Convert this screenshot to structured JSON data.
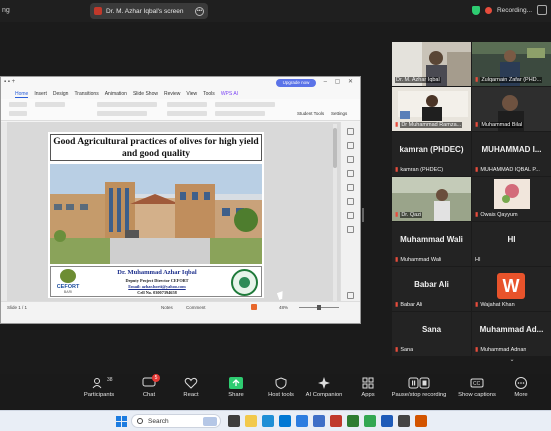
{
  "topbar": {
    "left_text": "ng",
    "share_indicator": "Dr. M. Azhar Iqbal's screen",
    "recording_label": "Recording..."
  },
  "document": {
    "upgrade_label": "Upgrade now",
    "ribbon_tabs": [
      "Home",
      "Insert",
      "Design",
      "Transitions",
      "Animation",
      "Slide Show",
      "Review",
      "View",
      "Tools",
      "WPS AI"
    ],
    "ribbon_labels": {
      "slide_tools": "Student Tools",
      "settings": "Settings"
    },
    "slide": {
      "title": "Good Agricultural practices of olives for high yield and good quality",
      "presenter": "Dr. Muhammad Azhar Iqbal",
      "designation": "Deputy Project Director CEFORT",
      "email": "Email: azhar.horti@yahoo.com",
      "cell": "Cell No. 03007394658",
      "logo_text": "CEFORT",
      "logo_sub": "BARI"
    },
    "statusbar": {
      "slide_num": "Slide 1 / 1",
      "notes": "Notes",
      "comment": "Comment",
      "zoom": "48%"
    }
  },
  "participants": [
    {
      "name": "Dr. M. Azhar Iqbal",
      "type": "video",
      "active": true,
      "muted": false
    },
    {
      "name": "Zulqarnain Zafar (PHD...",
      "type": "video",
      "muted": true
    },
    {
      "name": "Dr Muhammad Ramza...",
      "type": "video",
      "muted": true
    },
    {
      "name": "Muhammad Bilal",
      "type": "video",
      "muted": true
    },
    {
      "name": "kamran (PHDEC)",
      "big": "kamran  (PHDEC)",
      "type": "name",
      "muted": true
    },
    {
      "name": "MUHAMMAD IQBAL P...",
      "big": "MUHAMMAD  I...",
      "type": "name",
      "muted": true
    },
    {
      "name": "Dr. Qazi",
      "type": "video",
      "muted": true
    },
    {
      "name": "Owais Qayyum",
      "type": "video",
      "muted": true
    },
    {
      "name": "Muhammad Wali",
      "big": "Muhammad  Wali",
      "type": "name",
      "muted": true
    },
    {
      "name": "HI",
      "big": "HI",
      "type": "name",
      "muted": false
    },
    {
      "name": "Babar Ali",
      "big": "Babar  Ali",
      "type": "name",
      "muted": true
    },
    {
      "name": "Wajahat Khan",
      "big": "W",
      "type": "avatar",
      "muted": true
    },
    {
      "name": "Sana",
      "big": "Sana",
      "type": "name",
      "muted": true
    },
    {
      "name": "Muhammad Adnan",
      "big": "Muhammad  Ad...",
      "type": "name",
      "muted": true
    }
  ],
  "toolbar": {
    "participants_label": "Participants",
    "participants_count": "38",
    "chat_label": "Chat",
    "chat_badge": "5",
    "react_label": "React",
    "share_label": "Share",
    "host_tools_label": "Host tools",
    "ai_label": "AI Companion",
    "apps_label": "Apps",
    "record_label": "Pause/stop recording",
    "captions_label": "Show captions",
    "more_label": "More"
  },
  "taskbar": {
    "search_text": "Search"
  },
  "colors": {
    "accent_green": "#4cd964",
    "mute_red": "#e74c3c",
    "wps_blue": "#5b73e8"
  }
}
